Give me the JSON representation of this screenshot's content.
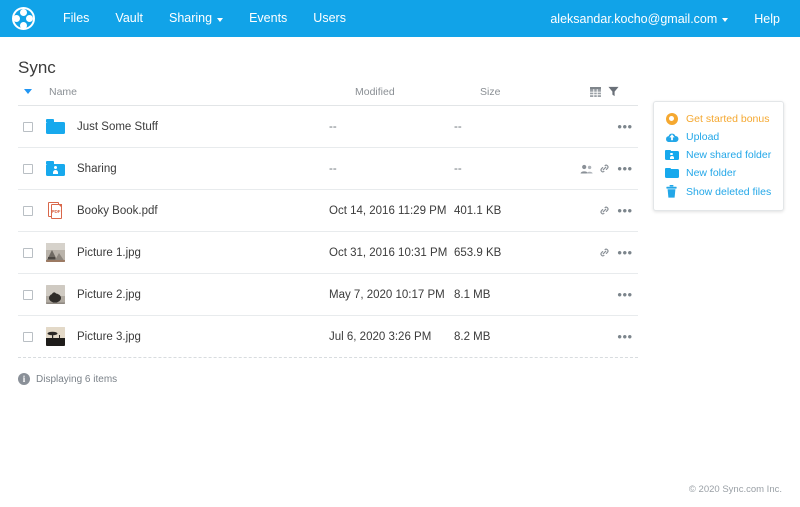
{
  "navbar": {
    "logo_name": "sync-logo",
    "brand_color": "#11a3e8",
    "links": [
      {
        "label": "Files",
        "has_caret": false
      },
      {
        "label": "Vault",
        "has_caret": false
      },
      {
        "label": "Sharing",
        "has_caret": true
      },
      {
        "label": "Events",
        "has_caret": false
      },
      {
        "label": "Users",
        "has_caret": false
      }
    ],
    "account": "aleksandar.kocho@gmail.com",
    "help": "Help"
  },
  "page": {
    "title": "Sync"
  },
  "table": {
    "columns": {
      "name": "Name",
      "modified": "Modified",
      "size": "Size"
    },
    "tool_icons": [
      "columns-grid-icon",
      "filter-funnel-icon"
    ],
    "rows": [
      {
        "name": "Just Some Stuff",
        "modified": "--",
        "size": "--",
        "icon": "folder-icon",
        "actions": [],
        "menu": "•••"
      },
      {
        "name": "Sharing",
        "modified": "--",
        "size": "--",
        "icon": "shared-folder-icon",
        "actions": [
          "people-icon",
          "link-icon"
        ],
        "menu": "•••"
      },
      {
        "name": "Booky Book.pdf",
        "modified": "Oct 14, 2016 11:29 PM",
        "size": "401.1 KB",
        "icon": "pdf-file-icon",
        "actions": [
          "link-icon"
        ],
        "menu": "•••"
      },
      {
        "name": "Picture 1.jpg",
        "modified": "Oct 31, 2016 10:31 PM",
        "size": "653.9 KB",
        "icon": "image-thumbnail",
        "actions": [
          "link-icon"
        ],
        "menu": "•••"
      },
      {
        "name": "Picture 2.jpg",
        "modified": "May 7, 2020 10:17 PM",
        "size": "8.1 MB",
        "icon": "image-thumbnail",
        "actions": [],
        "menu": "•••"
      },
      {
        "name": "Picture 3.jpg",
        "modified": "Jul 6, 2020 3:26 PM",
        "size": "8.2 MB",
        "icon": "image-thumbnail",
        "actions": [],
        "menu": "•••"
      }
    ],
    "footer_info": "Displaying 6 items",
    "footer_badge": "i"
  },
  "panel": {
    "items": [
      {
        "label": "Get started bonus",
        "icon": "star-badge-icon",
        "color": "#f5a830"
      },
      {
        "label": "Upload",
        "icon": "cloud-upload-icon",
        "color": "#23a7e8"
      },
      {
        "label": "New shared folder",
        "icon": "shared-folder-icon",
        "color": "#23a7e8"
      },
      {
        "label": "New folder",
        "icon": "folder-icon",
        "color": "#23a7e8"
      },
      {
        "label": "Show deleted files",
        "icon": "trash-icon",
        "color": "#23a7e8"
      }
    ]
  },
  "footer": {
    "copyright": "© 2020 Sync.com Inc."
  }
}
